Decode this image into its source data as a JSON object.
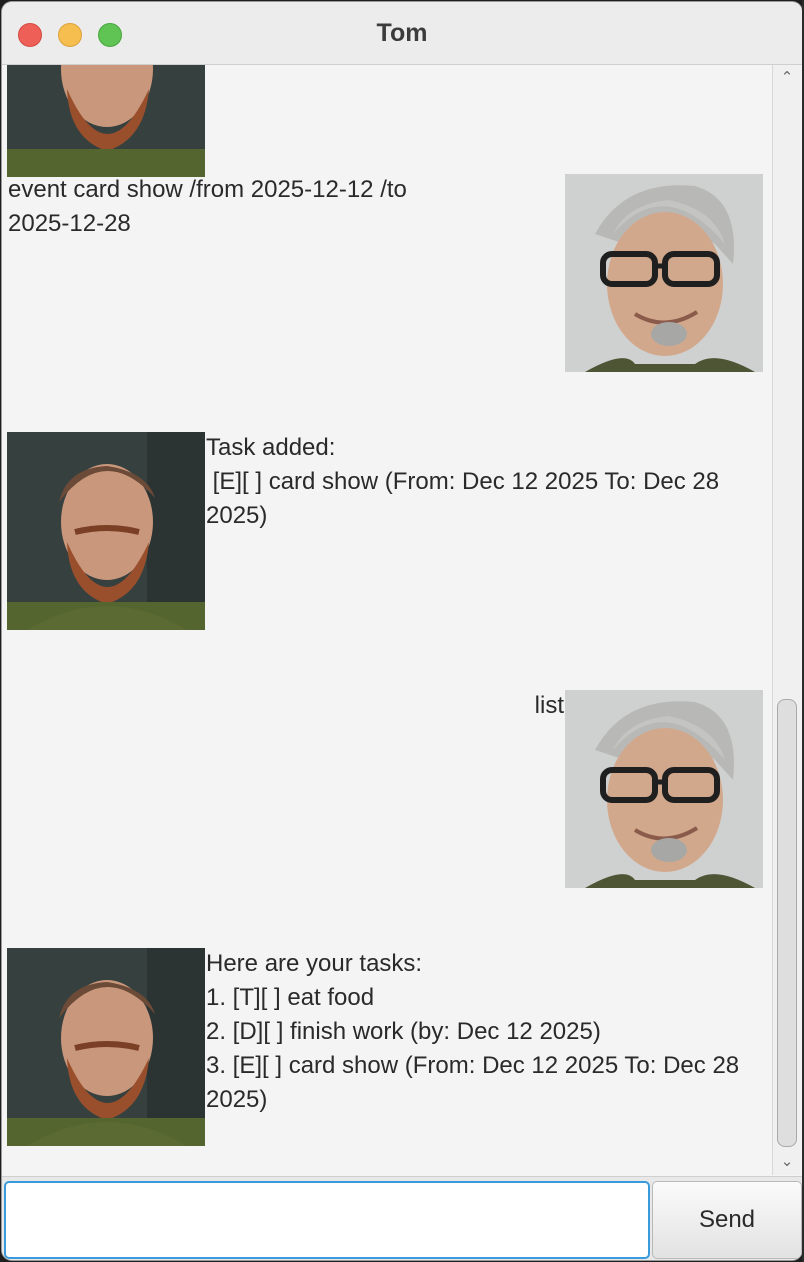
{
  "window": {
    "title": "Tom"
  },
  "dialog": [
    {
      "speaker": "bot",
      "avatar": "bearded-man-avatar",
      "text": ""
    },
    {
      "speaker": "user",
      "avatar": "glasses-man-avatar",
      "text": "event card show /from 2025-12-12 /to\n2025-12-28"
    },
    {
      "speaker": "bot",
      "avatar": "bearded-man-avatar",
      "text": "Task added:\n [E][ ] card show (From: Dec 12 2025 To: Dec 28\n2025)"
    },
    {
      "speaker": "user",
      "avatar": "glasses-man-avatar",
      "text": "list"
    },
    {
      "speaker": "bot",
      "avatar": "bearded-man-avatar",
      "text": "Here are your tasks:\n1. [T][ ] eat food\n2. [D][ ] finish work (by: Dec 12 2025)\n3. [E][ ] card show (From: Dec 12 2025 To: Dec 28\n2025)"
    }
  ],
  "input": {
    "value": "",
    "placeholder": ""
  },
  "send_button": {
    "label": "Send"
  },
  "colors": {
    "input_focus_border": "#3a9bdc",
    "background": "#f4f4f4"
  }
}
